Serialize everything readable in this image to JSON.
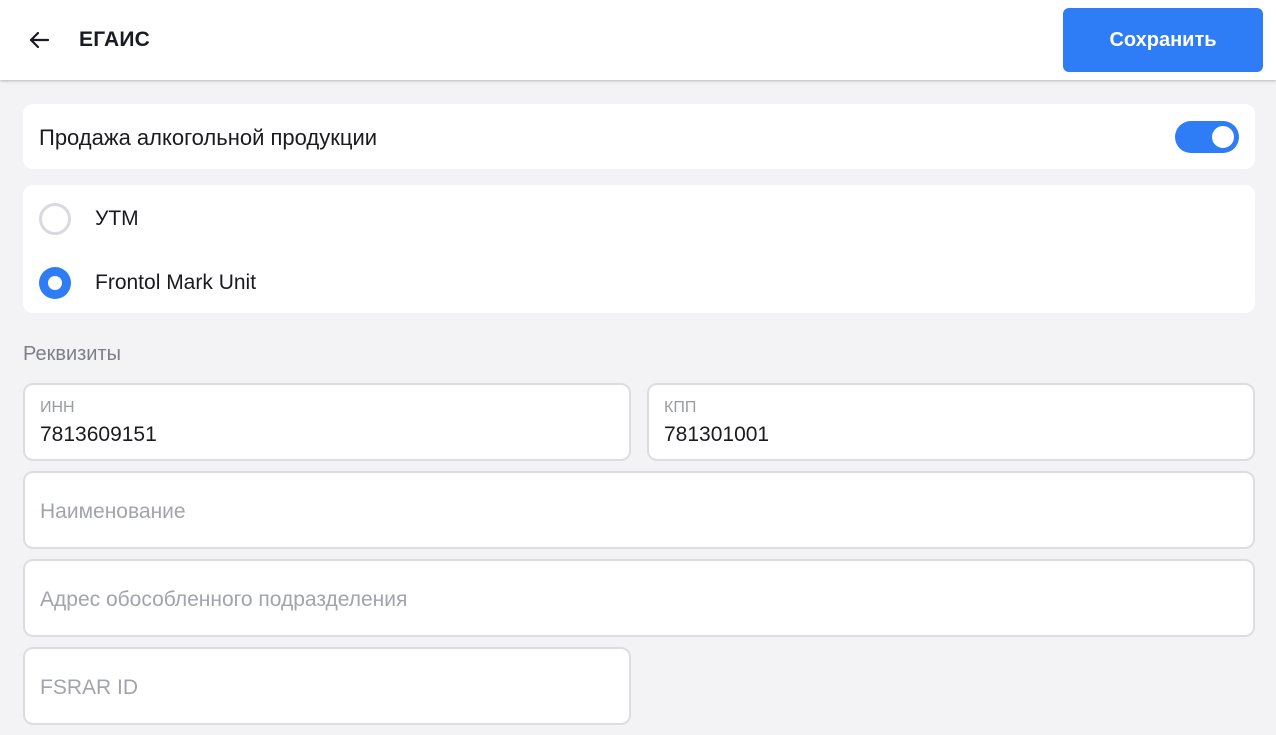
{
  "header": {
    "title": "ЕГАИС",
    "save_label": "Сохранить",
    "back_icon": "arrow-left-icon",
    "accent_color": "#2f7df6"
  },
  "alcohol_sale": {
    "label": "Продажа алкогольной продукции",
    "enabled": true
  },
  "mode": {
    "options": [
      {
        "label": "УТМ",
        "selected": false
      },
      {
        "label": "Frontol Mark Unit",
        "selected": true
      }
    ]
  },
  "requisites": {
    "title": "Реквизиты",
    "inn": {
      "label": "ИНН",
      "value": "7813609151"
    },
    "kpp": {
      "label": "КПП",
      "value": "781301001"
    },
    "name": {
      "placeholder": "Наименование"
    },
    "address": {
      "placeholder": "Адрес обособленного подразделения"
    },
    "fsrar": {
      "placeholder": "FSRAR ID"
    }
  }
}
